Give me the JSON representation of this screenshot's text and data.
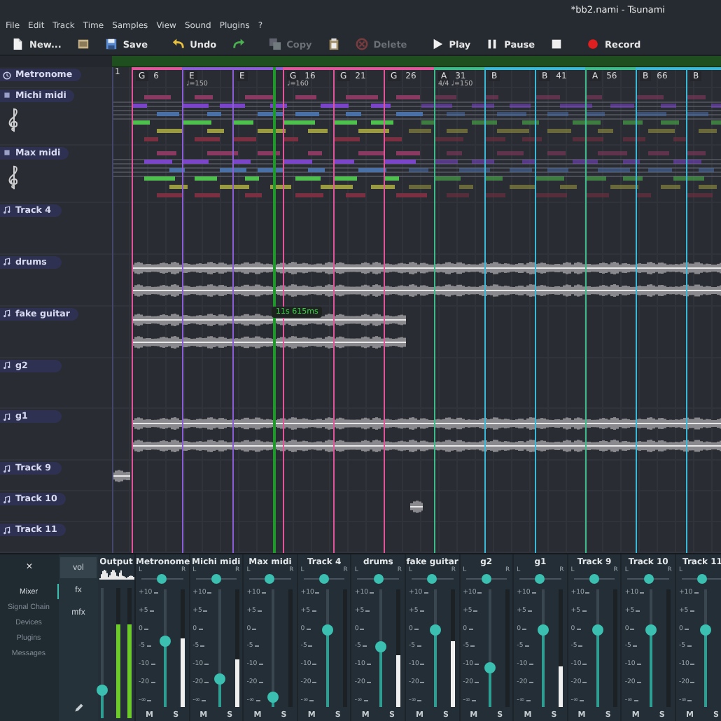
{
  "window": {
    "title": "*bb2.nami - Tsunami"
  },
  "menu": [
    "File",
    "Edit",
    "Track",
    "Time",
    "Samples",
    "View",
    "Sound",
    "Plugins",
    "?"
  ],
  "toolbar": [
    {
      "kind": "new",
      "label": "New...",
      "disabled": false
    },
    {
      "kind": "open",
      "disabled": false
    },
    {
      "kind": "save",
      "label": "Save",
      "disabled": false
    },
    {
      "kind": "undo",
      "label": "Undo",
      "disabled": false
    },
    {
      "kind": "redo",
      "disabled": false
    },
    {
      "kind": "copy",
      "label": "Copy",
      "disabled": true
    },
    {
      "kind": "paste",
      "disabled": false
    },
    {
      "kind": "delete",
      "label": "Delete",
      "disabled": true
    },
    {
      "kind": "play",
      "label": "Play",
      "disabled": false
    },
    {
      "kind": "pause",
      "label": "Pause",
      "disabled": false
    },
    {
      "kind": "stop",
      "disabled": false
    },
    {
      "kind": "record",
      "label": "Record",
      "disabled": false
    }
  ],
  "timeline": {
    "start": "1",
    "playhead_time": "11s 615ms"
  },
  "sections": [
    {
      "letter": "G",
      "number": "6",
      "color": "#e0559a"
    },
    {
      "letter": "E",
      "tempo": "♩=150",
      "color": "#8a5cd6"
    },
    {
      "letter": "E",
      "color": "#8a5cd6"
    },
    {
      "letter": "G",
      "number": "16",
      "tempo": "♩=160",
      "color": "#e0559a"
    },
    {
      "letter": "G",
      "number": "21",
      "color": "#e0559a"
    },
    {
      "letter": "G",
      "number": "26",
      "color": "#e0559a"
    },
    {
      "letter": "A",
      "number": "31",
      "tempo": "4/4 ♩=150",
      "color": "#3dbb8a"
    },
    {
      "letter": "B",
      "color": "#3ab8d8"
    },
    {
      "letter": "B",
      "number": "41",
      "color": "#3ab8d8"
    },
    {
      "letter": "A",
      "number": "56",
      "color": "#3dbb8a"
    },
    {
      "letter": "B",
      "number": "66",
      "color": "#3ab8d8"
    },
    {
      "letter": "B",
      "color": "#3ab8d8"
    }
  ],
  "tracks": [
    {
      "name": "Metronome",
      "kind": "metronome"
    },
    {
      "name": "Michi midi",
      "kind": "midi"
    },
    {
      "name": "Max midi",
      "kind": "midi"
    },
    {
      "name": "Track 4",
      "kind": "audio"
    },
    {
      "name": "drums",
      "kind": "audio",
      "clips": [
        {
          "kind": "full"
        }
      ]
    },
    {
      "name": "fake guitar",
      "kind": "audio",
      "clips": [
        {
          "kind": "partial"
        }
      ]
    },
    {
      "name": "g2",
      "kind": "audio"
    },
    {
      "name": "g1",
      "kind": "audio",
      "clips": [
        {
          "kind": "full"
        }
      ]
    },
    {
      "name": "Track 9",
      "kind": "audio",
      "clips": [
        {
          "kind": "short"
        }
      ]
    },
    {
      "name": "Track 10",
      "kind": "audio",
      "clips": [
        {
          "kind": "tail"
        }
      ]
    },
    {
      "name": "Track 11",
      "kind": "audio"
    }
  ],
  "mixer": {
    "close": "×",
    "nav": [
      {
        "label": "Mixer",
        "selected": true
      },
      {
        "label": "Signal Chain",
        "selected": false
      },
      {
        "label": "Devices",
        "selected": false
      },
      {
        "label": "Plugins",
        "selected": false
      },
      {
        "label": "Messages",
        "selected": false
      }
    ],
    "tabs": [
      {
        "label": "vol",
        "selected": true
      },
      {
        "label": "fx",
        "selected": false
      },
      {
        "label": "mfx",
        "selected": false
      }
    ],
    "output": {
      "name": "Output",
      "level": 0.21,
      "meters": [
        {
          "level": 0.72
        },
        {
          "level": 0.72
        }
      ]
    },
    "channels": [
      {
        "name": "Metronome",
        "pan": {
          "l": "L",
          "r": "R",
          "level": 0.5
        },
        "scale": [
          "+10",
          "+5",
          "0",
          "-5",
          "-10",
          "-20",
          "-∞"
        ],
        "level": 0.56,
        "meter": {
          "level": 0.58
        },
        "mute": "M",
        "solo": "S"
      },
      {
        "name": "Michi midi",
        "pan": {
          "l": "L",
          "r": "R",
          "level": 0.5
        },
        "scale": [
          "+10",
          "+5",
          "0",
          "-5",
          "-10",
          "-20",
          "-∞"
        ],
        "level": 0.24,
        "meter": {
          "level": 0.41
        },
        "mute": "M",
        "solo": "S"
      },
      {
        "name": "Max midi",
        "pan": {
          "l": "L",
          "r": "R",
          "level": 0.5
        },
        "scale": [
          "+10",
          "+5",
          "0",
          "-5",
          "-10",
          "-20",
          "-∞"
        ],
        "level": 0.08,
        "meter": {
          "level": 0
        },
        "mute": "M",
        "solo": "S"
      },
      {
        "name": "Track 4",
        "pan": {
          "l": "L",
          "r": "R",
          "level": 0.5
        },
        "scale": [
          "+10",
          "+5",
          "0",
          "-5",
          "-10",
          "-20",
          "-∞"
        ],
        "level": 0.66,
        "meter": {
          "level": 0
        },
        "mute": "M",
        "solo": "S"
      },
      {
        "name": "drums",
        "pan": {
          "l": "L",
          "r": "R",
          "level": 0.5
        },
        "scale": [
          "+10",
          "+5",
          "0",
          "-5",
          "-10",
          "-20",
          "-∞"
        ],
        "level": 0.51,
        "meter": {
          "level": 0.44
        },
        "mute": "M",
        "solo": "S"
      },
      {
        "name": "fake guitar",
        "pan": {
          "l": "L",
          "r": "R",
          "level": 0.5
        },
        "scale": [
          "+10",
          "+5",
          "0",
          "-5",
          "-10",
          "-20",
          "-∞"
        ],
        "level": 0.66,
        "meter": {
          "level": 0.56
        },
        "mute": "M",
        "solo": "S"
      },
      {
        "name": "g2",
        "pan": {
          "l": "L",
          "r": "R",
          "level": 0.5
        },
        "scale": [
          "+10",
          "+5",
          "0",
          "-5",
          "-10",
          "-20",
          "-∞"
        ],
        "level": 0.33,
        "meter": {
          "level": 0
        },
        "mute": "M",
        "solo": "S"
      },
      {
        "name": "g1",
        "pan": {
          "l": "L",
          "r": "R",
          "level": 0.5
        },
        "scale": [
          "+10",
          "+5",
          "0",
          "-5",
          "-10",
          "-20",
          "-∞"
        ],
        "level": 0.66,
        "meter": {
          "level": 0.34
        },
        "mute": "M",
        "solo": "S"
      },
      {
        "name": "Track 9",
        "pan": {
          "l": "L",
          "r": "R",
          "level": 0.5
        },
        "scale": [
          "+10",
          "+5",
          "0",
          "-5",
          "-10",
          "-20",
          "-∞"
        ],
        "level": 0.66,
        "meter": {
          "level": 0
        },
        "mute": "M",
        "solo": "S"
      },
      {
        "name": "Track 10",
        "pan": {
          "l": "L",
          "r": "R",
          "level": 0.5
        },
        "scale": [
          "+10",
          "+5",
          "0",
          "-5",
          "-10",
          "-20",
          "-∞"
        ],
        "level": 0.66,
        "meter": {
          "level": 0
        },
        "mute": "M",
        "solo": "S"
      },
      {
        "name": "Track 11",
        "pan": {
          "l": "L",
          "level": 0.5
        },
        "scale": [
          "+10",
          "+5",
          "0",
          "-5",
          "-10",
          "-20",
          "-∞"
        ],
        "level": 0.66,
        "meter": {
          "level": 0
        },
        "mute": "M",
        "solo": "S"
      }
    ]
  }
}
